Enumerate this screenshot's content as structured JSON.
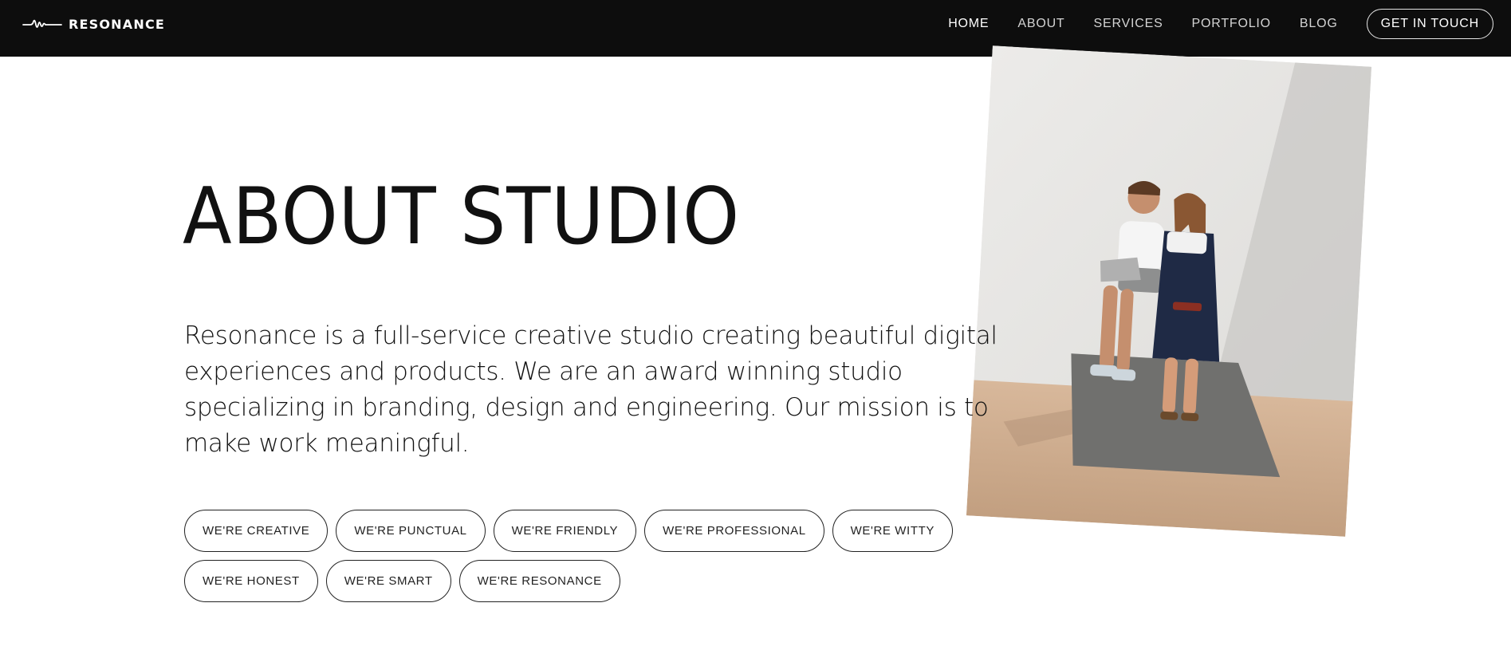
{
  "brand": {
    "name": "RESONANCE",
    "logo_icon": "waveform-icon"
  },
  "nav": {
    "items": [
      {
        "label": "HOME",
        "active": true
      },
      {
        "label": "ABOUT",
        "active": false
      },
      {
        "label": "SERVICES",
        "active": false
      },
      {
        "label": "PORTFOLIO",
        "active": false
      },
      {
        "label": "BLOG",
        "active": false
      }
    ],
    "cta_label": "GET IN TOUCH"
  },
  "hero": {
    "title": "ABOUT STUDIO",
    "description": "Resonance is a full-service creative studio creating beautiful digital experiences and products. We are an award winning studio specializing in branding, design and engineering. Our mission is to make work meaningful.",
    "tags": [
      "WE'RE CREATIVE",
      "WE'RE PUNCTUAL",
      "WE'RE FRIENDLY",
      "WE'RE PROFESSIONAL",
      "WE'RE WITTY",
      "WE'RE HONEST",
      "WE'RE SMART",
      "WE'RE RESONANCE"
    ]
  },
  "colors": {
    "header_bg": "#0d0d0d",
    "text": "#111111",
    "wall": "#e7e7e5",
    "floor": "#c9a98c"
  }
}
